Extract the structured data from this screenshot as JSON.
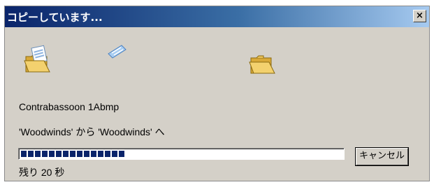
{
  "window": {
    "title": "コピーしています...",
    "close_label": "×"
  },
  "status": {
    "file_name": "Contrabassoon 1Abmp",
    "from_to": "'Woodwinds' から 'Woodwinds' へ",
    "time_remaining": "残り 20 秒",
    "progress_fraction": 0.33
  },
  "buttons": {
    "cancel_label": "キャンセル"
  },
  "icons": {
    "source": "source-folder-icon",
    "flying": "flying-document-icon",
    "destination": "destination-folder-icon"
  },
  "colors": {
    "title_bar": "#0a246a",
    "progress": "#0a246a",
    "face": "#d4d0c8"
  }
}
